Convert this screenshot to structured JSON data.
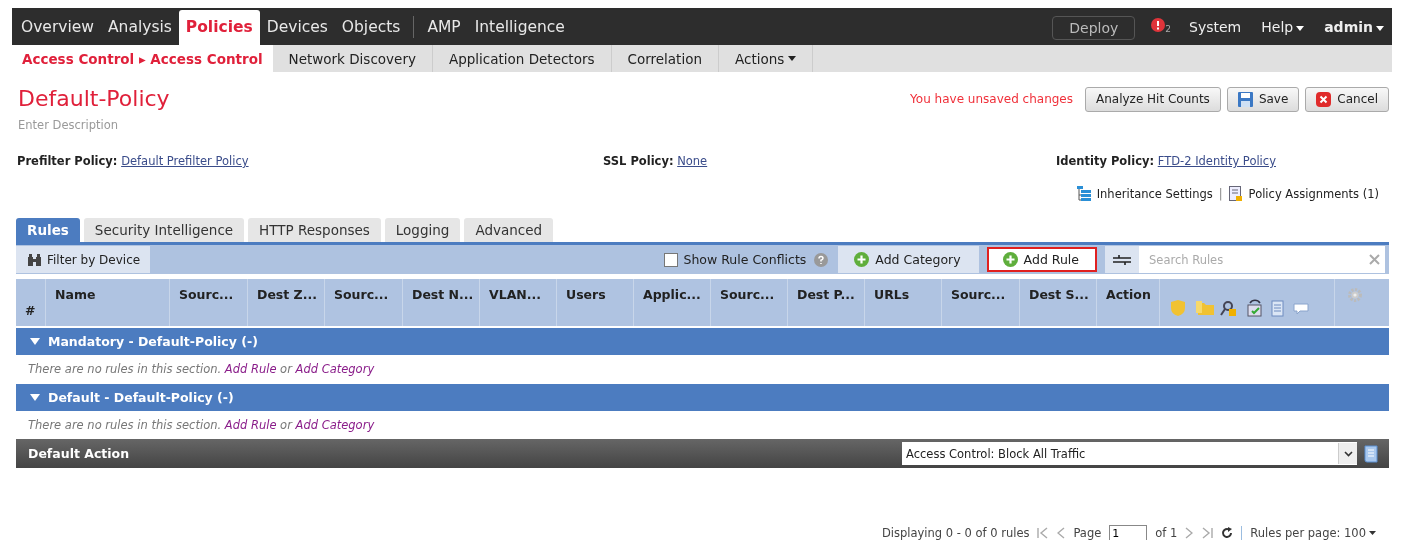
{
  "top_nav": {
    "items": [
      {
        "label": "Overview",
        "selected": false
      },
      {
        "label": "Analysis",
        "selected": false
      },
      {
        "label": "Policies",
        "selected": true
      },
      {
        "label": "Devices",
        "selected": false
      },
      {
        "label": "Objects",
        "selected": false
      },
      {
        "label": "AMP",
        "selected": false
      },
      {
        "label": "Intelligence",
        "selected": false
      }
    ],
    "deploy": "Deploy",
    "alert_count": "2",
    "system": "System",
    "help": "Help",
    "user": "admin"
  },
  "sub_nav": {
    "items": [
      {
        "label": "Access Control ▸ Access Control",
        "selected": true
      },
      {
        "label": "Network Discovery",
        "selected": false
      },
      {
        "label": "Application Detectors",
        "selected": false
      },
      {
        "label": "Correlation",
        "selected": false
      },
      {
        "label": "Actions",
        "selected": false
      }
    ]
  },
  "policy": {
    "title": "Default-Policy",
    "description_placeholder": "Enter Description",
    "unsaved": "You have unsaved changes",
    "buttons": [
      {
        "kind": "plain",
        "label": "Analyze Hit Counts"
      },
      {
        "kind": "save",
        "label": "Save"
      },
      {
        "kind": "cancel",
        "label": "Cancel"
      }
    ]
  },
  "policies": [
    {
      "label": "Prefilter Policy:",
      "value": "Default Prefilter Policy"
    },
    {
      "label": "SSL Policy:",
      "value": "None"
    },
    {
      "label": "Identity Policy:",
      "value": "FTD-2 Identity Policy"
    }
  ],
  "links": {
    "inheritance": "Inheritance Settings",
    "separator": "|",
    "assignments": "Policy Assignments (1)"
  },
  "tabs": [
    {
      "label": "Rules",
      "selected": true
    },
    {
      "label": "Security Intelligence",
      "selected": false
    },
    {
      "label": "HTTP Responses",
      "selected": false
    },
    {
      "label": "Logging",
      "selected": false
    },
    {
      "label": "Advanced",
      "selected": false
    }
  ],
  "toolbar": {
    "filter": "Filter by Device",
    "show_conflicts": {
      "label": "Show Rule Conflicts",
      "checked": false
    },
    "buttons": [
      {
        "label": "Add Category",
        "highlighted": false
      },
      {
        "label": "Add Rule",
        "highlighted": true
      }
    ],
    "search_placeholder": "Search Rules"
  },
  "table": {
    "columns": [
      "#",
      "Name",
      "Sourc...",
      "Dest Z...",
      "Sourc...",
      "Dest N...",
      "VLAN...",
      "Users",
      "Applic...",
      "Sourc...",
      "Dest P...",
      "URLs",
      "Sourc...",
      "Dest S...",
      "Action"
    ],
    "sections": [
      {
        "title": "Mandatory - Default-Policy (-)",
        "expanded": true,
        "empty_text": "There are no rules in this section.",
        "add_rule": "Add Rule",
        "or": "or",
        "add_category": "Add Category"
      },
      {
        "title": "Default - Default-Policy (-)",
        "expanded": true,
        "empty_text": "There are no rules in this section.",
        "add_rule": "Add Rule",
        "or": "or",
        "add_category": "Add Category"
      }
    ]
  },
  "default_action": {
    "label": "Default Action",
    "value": "Access Control: Block All Traffic"
  },
  "pagination": {
    "summary": "Displaying 0 - 0 of 0 rules",
    "page_label": "Page",
    "page": "1",
    "of": "of 1",
    "per_page": "Rules per page: 100"
  }
}
